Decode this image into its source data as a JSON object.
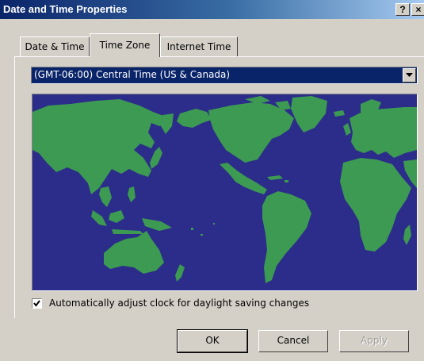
{
  "window": {
    "title": "Date and Time Properties",
    "help_button": "?",
    "close_button": "×"
  },
  "tabs": [
    {
      "label": "Date & Time",
      "active": false
    },
    {
      "label": "Time Zone",
      "active": true
    },
    {
      "label": "Internet Time",
      "active": false
    }
  ],
  "timezone": {
    "selected": "(GMT-06:00) Central Time (US & Canada)"
  },
  "map": {
    "icon": "world-map",
    "ocean_color": "#2c2c8a",
    "land_color": "#3c9a52"
  },
  "daylight": {
    "label": "Automatically adjust clock for daylight saving changes",
    "checked": true
  },
  "buttons": {
    "ok": "OK",
    "cancel": "Cancel",
    "apply": "Apply"
  },
  "colors": {
    "face": "#d4d0c8",
    "title_start": "#0a246a",
    "title_end": "#a6caf0",
    "selection": "#0a246a"
  }
}
